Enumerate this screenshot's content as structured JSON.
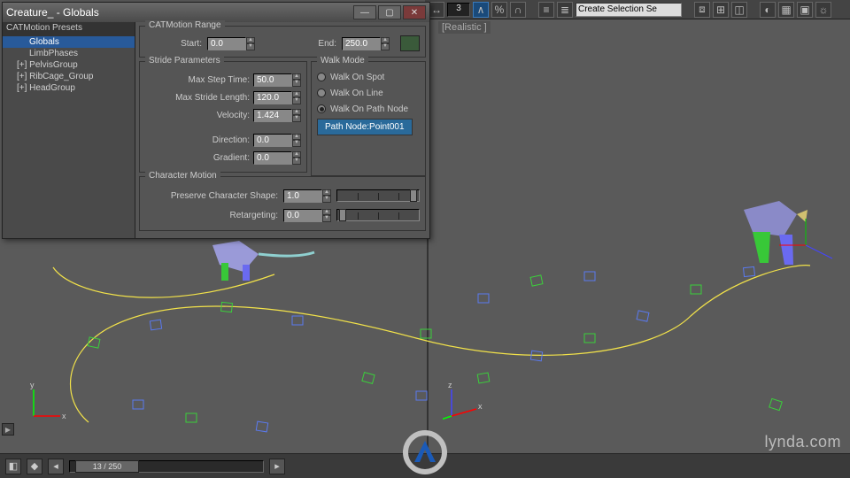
{
  "toolbar": {
    "num": "3",
    "selection_dropdown": "Create Selection Se"
  },
  "viewport": {
    "label": "[Realistic ]"
  },
  "dialog": {
    "title": "Creature_ - Globals",
    "tree": {
      "header": "CATMotion Presets",
      "items": [
        {
          "label": "Globals",
          "selected": true,
          "indent": true
        },
        {
          "label": "LimbPhases",
          "selected": false,
          "indent": true
        },
        {
          "label": "[+] PelvisGroup",
          "selected": false,
          "indent": false
        },
        {
          "label": "[+] RibCage_Group",
          "selected": false,
          "indent": false
        },
        {
          "label": "[+] HeadGroup",
          "selected": false,
          "indent": false
        }
      ]
    },
    "range": {
      "title": "CATMotion Range",
      "start_label": "Start:",
      "start_value": "0.0",
      "end_label": "End:",
      "end_value": "250.0"
    },
    "stride": {
      "title": "Stride Parameters",
      "max_step_time_label": "Max Step Time:",
      "max_step_time": "50.0",
      "max_stride_len_label": "Max Stride Length:",
      "max_stride_len": "120.0",
      "velocity_label": "Velocity:",
      "velocity": "1.424",
      "direction_label": "Direction:",
      "direction": "0.0",
      "gradient_label": "Gradient:",
      "gradient": "0.0"
    },
    "walk": {
      "title": "Walk Mode",
      "opt_spot": "Walk On Spot",
      "opt_line": "Walk On Line",
      "opt_path": "Walk On Path Node",
      "path_btn": "Path Node:Point001"
    },
    "charmo": {
      "title": "Character Motion",
      "preserve_label": "Preserve Character Shape:",
      "preserve_value": "1.0",
      "retarget_label": "Retargeting:",
      "retarget_value": "0.0"
    }
  },
  "timeline": {
    "frame_display": "13 / 250"
  },
  "watermark": "lynda.com"
}
